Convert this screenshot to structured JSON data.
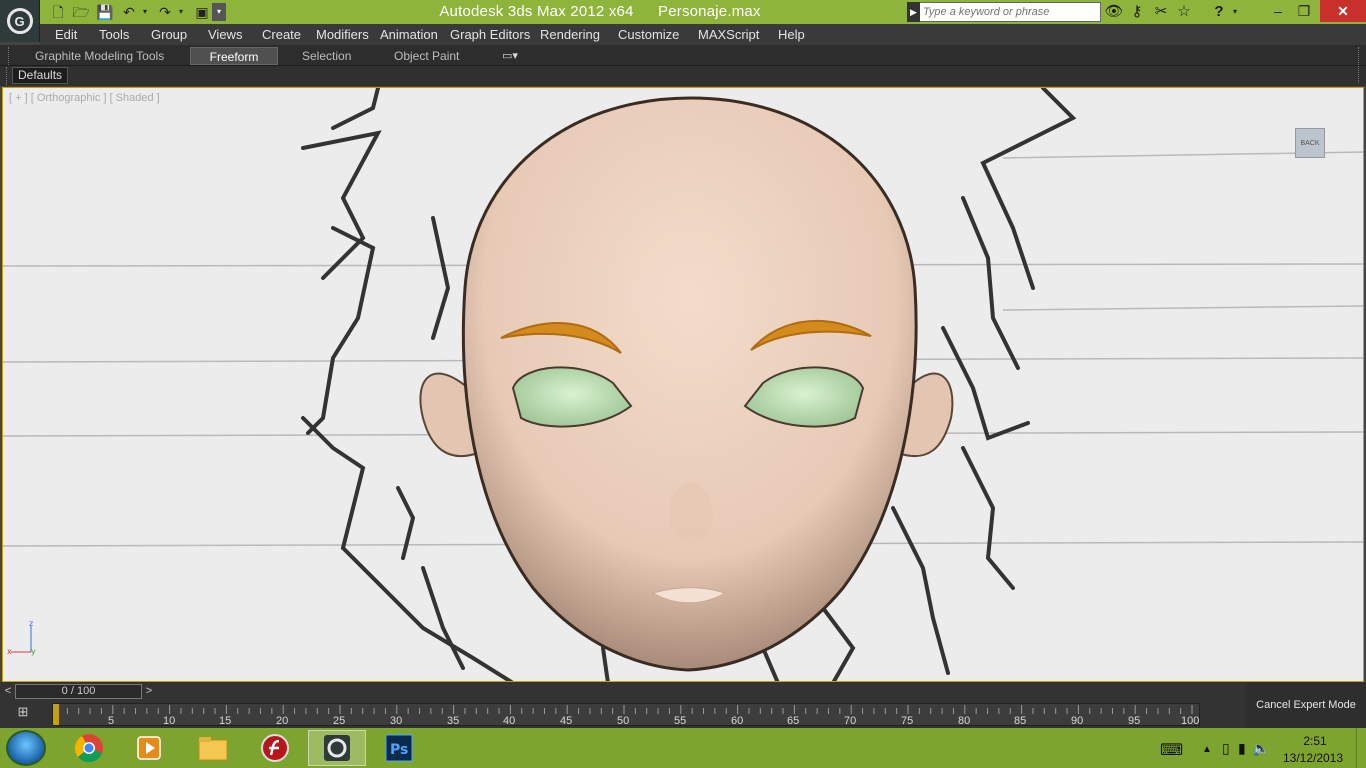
{
  "window": {
    "app_name": "Autodesk 3ds Max  2012 x64",
    "file_name": "Personaje.max"
  },
  "search": {
    "placeholder": "Type a keyword or phrase"
  },
  "menu": [
    "Edit",
    "Tools",
    "Group",
    "Views",
    "Create",
    "Modifiers",
    "Animation",
    "Graph Editors",
    "Rendering",
    "Customize",
    "MAXScript",
    "Help"
  ],
  "ribbon": {
    "tabs": [
      "Graphite Modeling Tools",
      "Freeform",
      "Selection",
      "Object Paint"
    ],
    "active_tab": "Freeform",
    "panel_label": "Defaults"
  },
  "viewport": {
    "label": "[ + ] [ Orthographic ] [ Shaded ]",
    "viewcube_label": "BACK",
    "axis": {
      "z": "z",
      "x": "x",
      "y": "y"
    }
  },
  "timeline": {
    "frame_display": "0 / 100",
    "prev": "<",
    "next": ">",
    "ticks": [
      "5",
      "10",
      "15",
      "20",
      "25",
      "30",
      "35",
      "40",
      "45",
      "50",
      "55",
      "60",
      "65",
      "70",
      "75",
      "80",
      "85",
      "90",
      "95",
      "100"
    ],
    "cancel_expert_label": "Cancel Expert Mode"
  },
  "taskbar": {
    "time": "2:51",
    "date": "13/12/2013",
    "apps": [
      "chrome",
      "media-player",
      "file-explorer",
      "flash",
      "3ds-max",
      "photoshop"
    ],
    "ps_label": "Ps"
  },
  "colors": {
    "titlebar": "#8fb43c",
    "taskbar": "#7ea430",
    "skin": "#f0d6c4",
    "eyebrow": "#d48a1c",
    "eye": "#c8e8c0"
  }
}
